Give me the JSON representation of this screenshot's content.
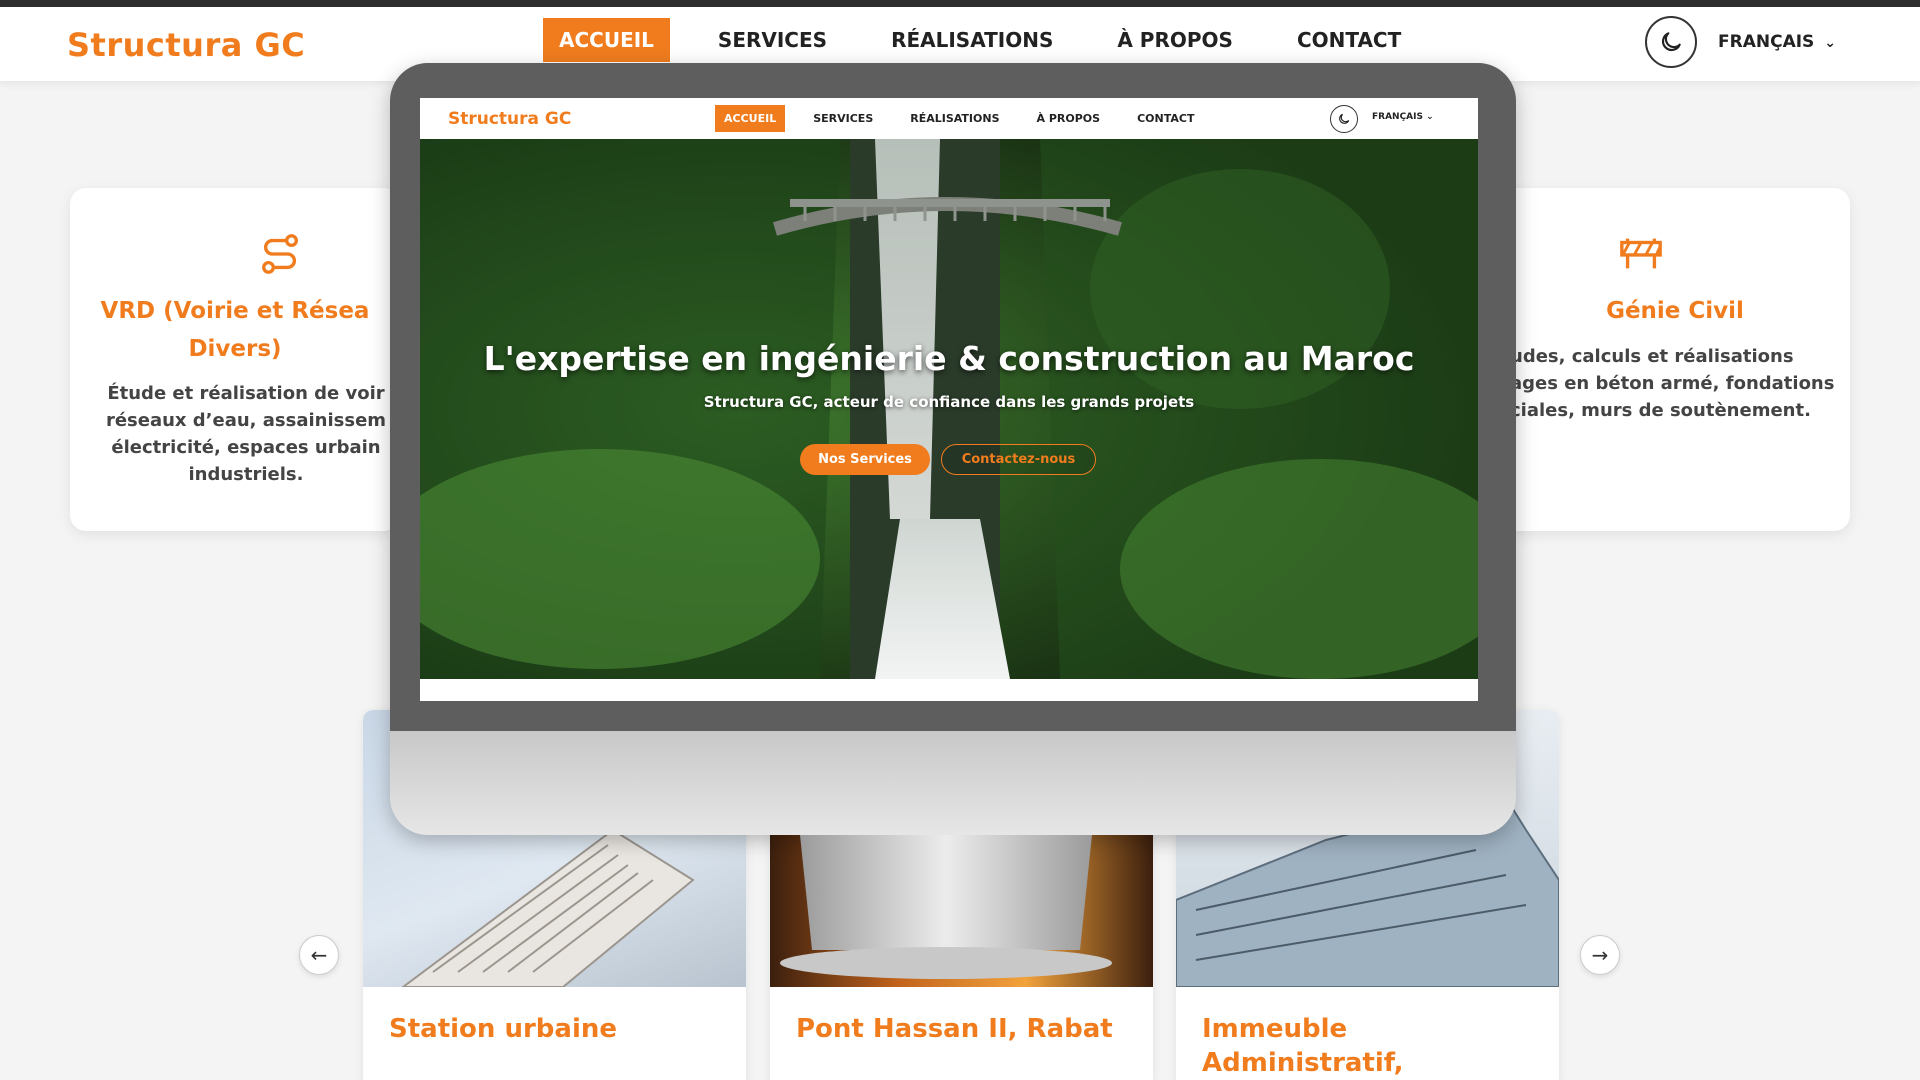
{
  "bg_header": {
    "logo": "Structura GC",
    "nav": [
      "ACCUEIL",
      "SERVICES",
      "RÉALISATIONS",
      "À PROPOS",
      "CONTACT"
    ],
    "active_index": 0,
    "theme_toggle_icon": "moon-icon",
    "language": "FRANÇAIS"
  },
  "services": {
    "left": {
      "icon": "route-icon",
      "title_line1": "VRD (Voirie et Résea",
      "title_line2": "Divers)",
      "text_line1": "Étude et réalisation de voir",
      "text_line2": "réseaux d’eau, assainissem",
      "text_line3": "électricité, espaces urbain",
      "text_line4": "industriels."
    },
    "right": {
      "icon": "barrier-icon",
      "title": "Génie Civil",
      "text_line1": "udes, calculs et réalisations",
      "text_line2": "ages en béton armé, fondations",
      "text_line3": "ciales, murs de soutènement."
    }
  },
  "projects": [
    {
      "title": "Station urbaine"
    },
    {
      "title": "Pont Hassan II, Rabat"
    },
    {
      "title_line1": "Immeuble",
      "title_line2": "Administratif,"
    }
  ],
  "carousel": {
    "prev_icon": "arrow-left-icon",
    "next_icon": "arrow-right-icon"
  },
  "monitor_screen": {
    "logo": "Structura GC",
    "nav": [
      "ACCUEIL",
      "SERVICES",
      "RÉALISATIONS",
      "À PROPOS",
      "CONTACT"
    ],
    "language": "FRANÇAIS",
    "hero": {
      "title": "L'expertise en ingénierie & construction au Maroc",
      "subtitle": "Structura GC, acteur de confiance dans les grands projets",
      "primary_button": "Nos Services",
      "secondary_button": "Contactez-nous"
    }
  },
  "colors": {
    "accent": "#f07c1e",
    "bezel": "#5e5e5e"
  }
}
